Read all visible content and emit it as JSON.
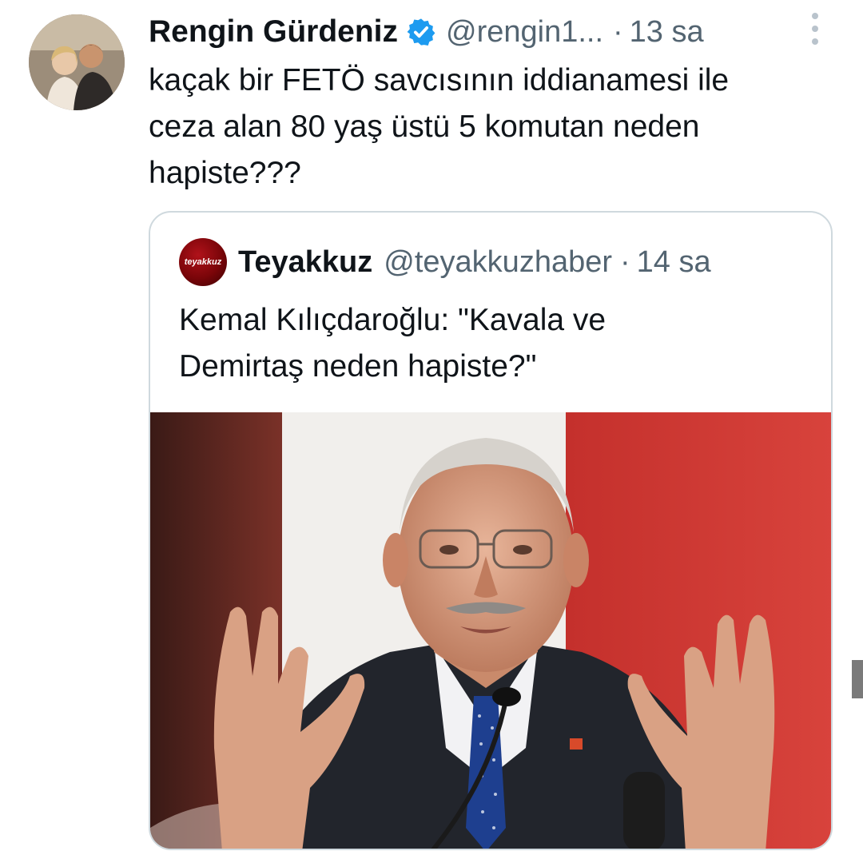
{
  "tweet": {
    "author_name": "Rengin Gürdeniz",
    "author_handle": "@rengin1...",
    "separator": "·",
    "time": "13 sa",
    "text": "kaçak bir FETÖ savcısının iddianamesi ile\nceza alan 80 yaş üstü 5 komutan neden\nhapiste???",
    "icons": [
      "verified-badge-icon",
      "more-options-icon"
    ],
    "colors": {
      "verified": "#1d9bf0",
      "handle": "#536471",
      "border": "#cfd9de"
    }
  },
  "quoted_tweet": {
    "author_name": "Teyakkuz",
    "author_handle": "@teyakkuzhaber",
    "separator": "·",
    "time": "14 sa",
    "avatar_text": "teyakkuz",
    "text": "Kemal Kılıçdaroğlu: \"Kavala ve\nDemirtaş neden hapiste?\""
  }
}
